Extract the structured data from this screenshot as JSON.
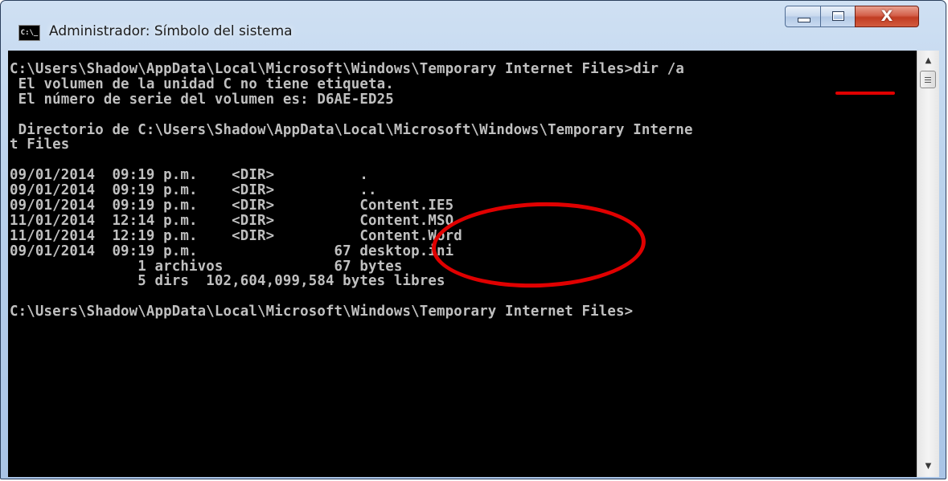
{
  "window": {
    "title": "Administrador: Símbolo del sistema",
    "icon_text": "C:\\_",
    "icon": "cmd-prompt-icon",
    "controls": {
      "minimize_icon": "minimize-icon",
      "maximize_icon": "maximize-icon",
      "close_icon": "close-icon",
      "close_label": "X"
    }
  },
  "console": {
    "lines": [
      "C:\\Users\\Shadow\\AppData\\Local\\Microsoft\\Windows\\Temporary Internet Files>dir /a",
      " El volumen de la unidad C no tiene etiqueta.",
      " El número de serie del volumen es: D6AE-ED25",
      "",
      " Directorio de C:\\Users\\Shadow\\AppData\\Local\\Microsoft\\Windows\\Temporary Interne",
      "t Files",
      "",
      "09/01/2014  09:19 p.m.    <DIR>          .",
      "09/01/2014  09:19 p.m.    <DIR>          ..",
      "09/01/2014  09:19 p.m.    <DIR>          Content.IE5",
      "11/01/2014  12:14 p.m.    <DIR>          Content.MSO",
      "11/01/2014  12:19 p.m.    <DIR>          Content.Word",
      "09/01/2014  09:19 p.m.                67 desktop.ini",
      "               1 archivos             67 bytes",
      "               5 dirs  102,604,099,584 bytes libres",
      "",
      "C:\\Users\\Shadow\\AppData\\Local\\Microsoft\\Windows\\Temporary Internet Files>"
    ]
  },
  "scrollbar": {
    "up_arrow": "▲",
    "down_arrow": "▼"
  },
  "annotations": {
    "color": "#e00000",
    "underline_target": "dir /a",
    "circle_target": "Content.IE5, Content.MSO, Content.Word"
  }
}
